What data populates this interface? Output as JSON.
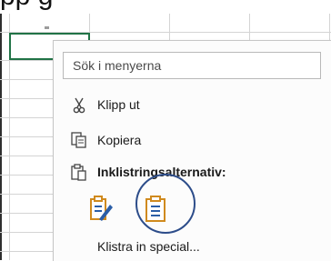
{
  "caption": {
    "text": "pp                       g"
  },
  "menu": {
    "search_placeholder": "Sök i menyerna",
    "items": [
      {
        "label": "Klipp ut",
        "icon": "scissors-icon"
      },
      {
        "label": "Kopiera",
        "icon": "copy-icon"
      },
      {
        "label": "Inklistringsalternativ:",
        "icon": "paste-options-icon"
      }
    ],
    "paste_options": [
      {
        "icon": "paste-keep-formatting-icon"
      },
      {
        "icon": "paste-icon"
      }
    ],
    "special_label": "Klistra in special..."
  },
  "colors": {
    "selection": "#217346",
    "highlight_circle": "#2d4d8a",
    "icon_orange": "#d08a1e",
    "icon_blue": "#2b5ea7"
  }
}
